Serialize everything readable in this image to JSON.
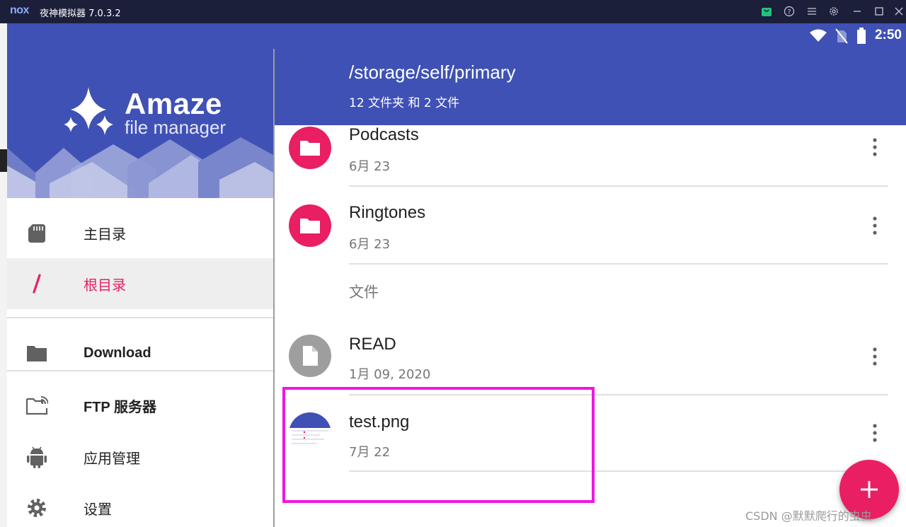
{
  "emulator": {
    "logo": "nox",
    "title": "夜神模拟器 7.0.3.2",
    "controls": [
      "bag-icon",
      "help-icon",
      "menu-icon",
      "settings-icon",
      "minimize-icon",
      "maximize-icon",
      "close-icon"
    ]
  },
  "status_bar": {
    "time": "2:50",
    "icons": [
      "wifi-icon",
      "no-sim-icon",
      "battery-icon"
    ]
  },
  "drawer": {
    "brand": {
      "title": "Amaze",
      "subtitle": "file manager"
    },
    "items": [
      {
        "label": "主目录",
        "icon": "sd-card-icon",
        "active": false
      },
      {
        "label": "根目录",
        "icon": "slash-icon",
        "active": true
      },
      {
        "label": "Download",
        "icon": "folder-icon",
        "active": false
      },
      {
        "label": "FTP 服务器",
        "icon": "ftp-folder-icon",
        "active": false
      },
      {
        "label": "应用管理",
        "icon": "android-icon",
        "active": false
      },
      {
        "label": "设置",
        "icon": "gear-icon",
        "active": false
      }
    ]
  },
  "main": {
    "path": "/storage/self/primary",
    "summary": "12 文件夹 和 2 文件",
    "folders": [
      {
        "name": "Podcasts",
        "date": "6月 23"
      },
      {
        "name": "Ringtones",
        "date": "6月 23"
      }
    ],
    "files_section_label": "文件",
    "files": [
      {
        "name": "READ",
        "date": "1月 09, 2020"
      },
      {
        "name": "test.png",
        "date": "7月 22"
      }
    ]
  },
  "colors": {
    "primary": "#3f51b5",
    "accent": "#e91e63",
    "highlight": "#f016e0"
  },
  "fab": {
    "icon": "plus-icon"
  },
  "watermark": "CSDN @默默爬行的虫虫"
}
